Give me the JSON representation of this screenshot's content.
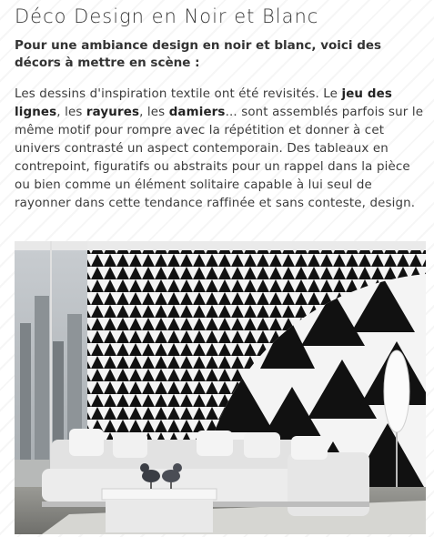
{
  "article": {
    "title": "Déco Design en Noir et Blanc",
    "subtitle": "Pour une ambiance design en noir et blanc, voici des décors à mettre en scène :",
    "body": {
      "t1": "Les dessins d'inspiration textile ont été revisités. Le ",
      "b1": "jeu des lignes",
      "t2": ", les ",
      "b2": "rayures",
      "t3": ", les ",
      "b3": "damiers",
      "t4": "... sont assemblés parfois sur le même motif pour rompre avec la répétition et donner à cet univers contrasté un aspect contemporain. Des tableaux en contrepoint, figuratifs ou abstraits pour un rappel dans la pièce ou bien comme un élément solitaire capable à lui seul de rayonner dans cette tendance raffinée et sans conteste, design."
    }
  },
  "photo": {
    "subject": "black-and-white-living-room-wallpaper",
    "colors": {
      "black": "#111111",
      "white": "#f4f4f4",
      "floor": "#8a8a86",
      "sofa": "#ececec"
    }
  }
}
